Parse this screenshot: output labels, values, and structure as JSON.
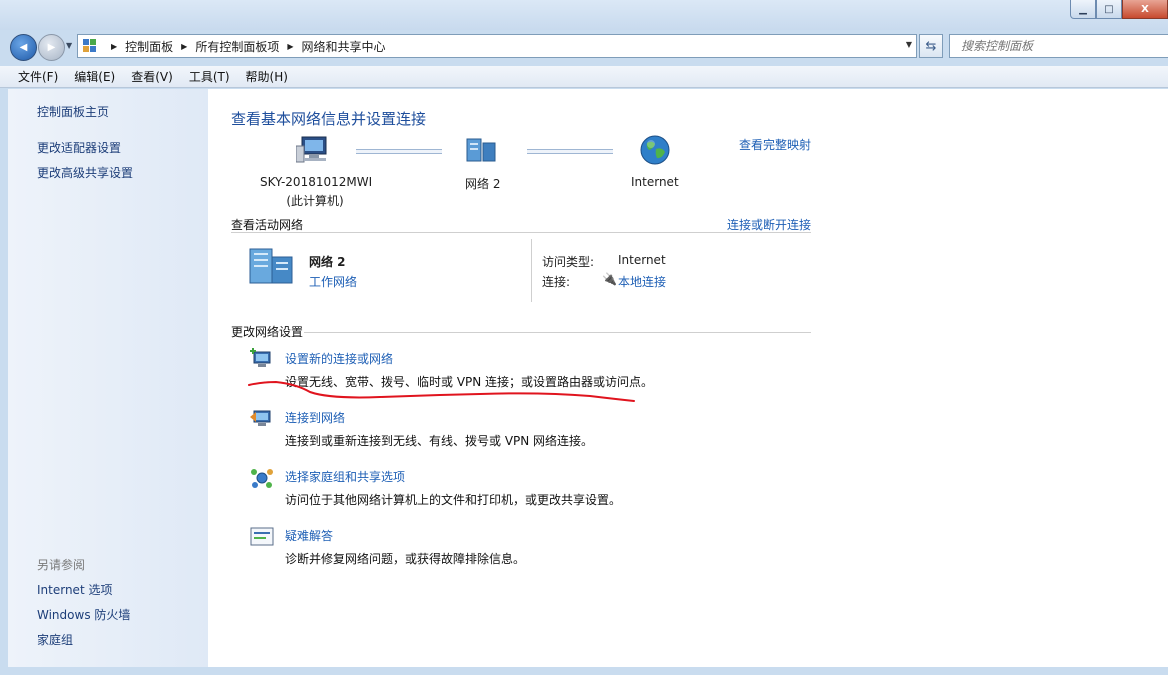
{
  "window": {
    "minimize": "▁",
    "maximize": "□",
    "close": "X"
  },
  "nav": {
    "back": "◀",
    "forward": "▶",
    "breadcrumbs": [
      "控制面板",
      "所有控制面板项",
      "网络和共享中心"
    ],
    "search_placeholder": "搜索控制面板"
  },
  "menu": [
    "文件(F)",
    "编辑(E)",
    "查看(V)",
    "工具(T)",
    "帮助(H)"
  ],
  "sidebar": {
    "home": "控制面板主页",
    "links": [
      "更改适配器设置",
      "更改高级共享设置"
    ],
    "see_also_header": "另请参阅",
    "see_also": [
      "Internet 选项",
      "Windows 防火墙",
      "家庭组"
    ]
  },
  "main": {
    "title": "查看基本网络信息并设置连接",
    "full_map": "查看完整映射",
    "map": {
      "computer_name": "SKY-20181012MWI",
      "computer_sub": "(此计算机)",
      "network": "网络  2",
      "internet": "Internet"
    },
    "active_label": "查看活动网络",
    "connect_disconnect": "连接或断开连接",
    "active": {
      "network_name": "网络  2",
      "network_type": "工作网络",
      "access_type_label": "访问类型:",
      "access_type_value": "Internet",
      "connection_label": "连接:",
      "connection_value": "本地连接"
    },
    "change_label": "更改网络设置",
    "tasks": [
      {
        "title": "设置新的连接或网络",
        "desc": "设置无线、宽带、拨号、临时或 VPN 连接；或设置路由器或访问点。"
      },
      {
        "title": "连接到网络",
        "desc": "连接到或重新连接到无线、有线、拨号或 VPN 网络连接。"
      },
      {
        "title": "选择家庭组和共享选项",
        "desc": "访问位于其他网络计算机上的文件和打印机，或更改共享设置。"
      },
      {
        "title": "疑难解答",
        "desc": "诊断并修复网络问题，或获得故障排除信息。"
      }
    ]
  },
  "colors": {
    "link": "#1e5fb5",
    "annotation": "#e0141e"
  }
}
